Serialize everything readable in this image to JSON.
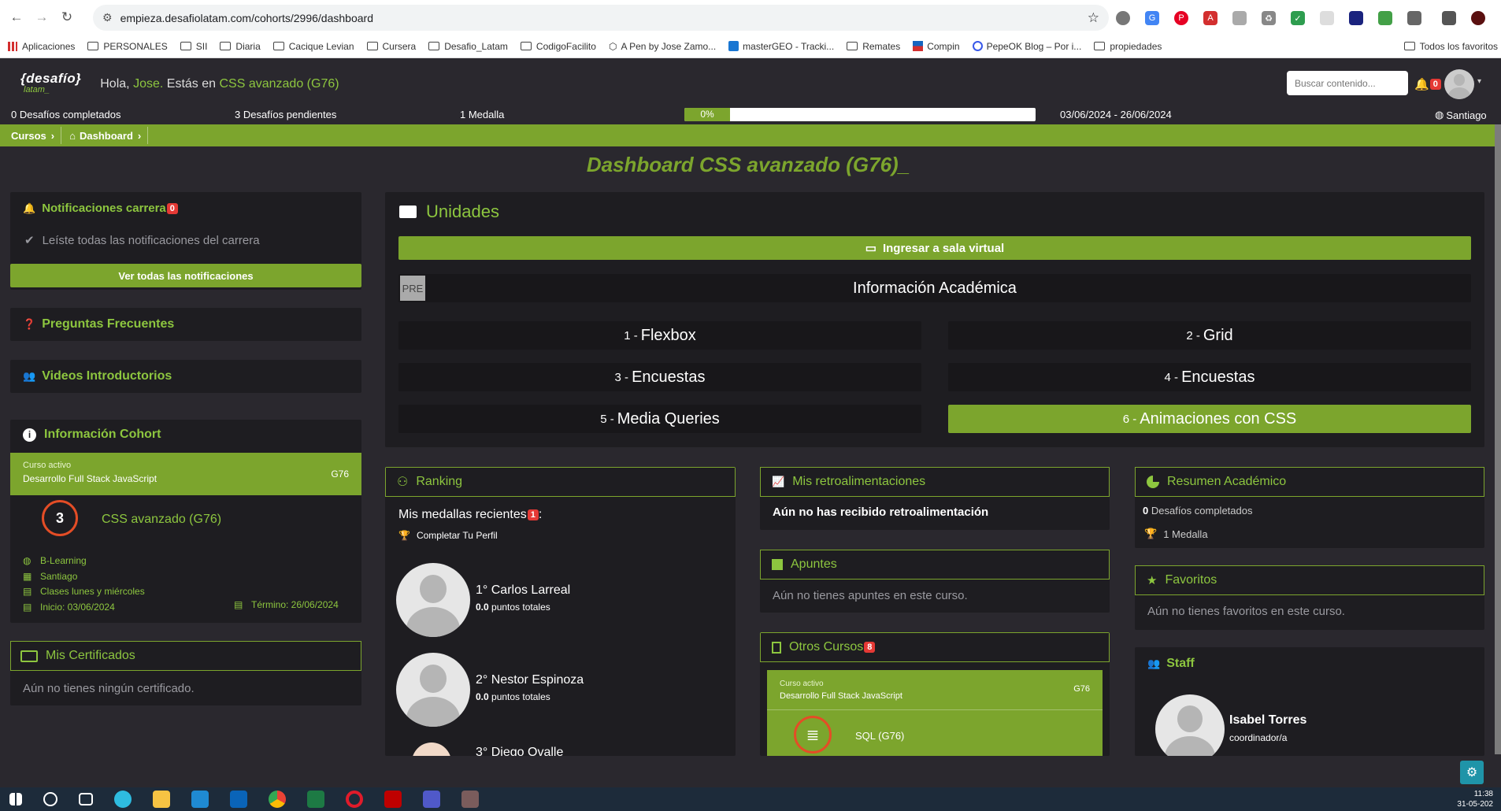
{
  "browser": {
    "url": "empieza.desafiolatam.com/cohorts/2996/dashboard",
    "bookmarks": [
      "Aplicaciones",
      "PERSONALES",
      "SII",
      "Diaria",
      "Cacique Levian",
      "Cursera",
      "Desafio_Latam",
      "CodigoFacilito",
      "A Pen by Jose Zamo...",
      "masterGEO - Tracki...",
      "Remates",
      "Compin",
      "PepeOK Blog – Por i...",
      "propiedades"
    ],
    "all_favorites": "Todos los favoritos"
  },
  "header": {
    "logo_top": "{desafío}",
    "logo_bottom": "latam_",
    "hola": "Hola,",
    "user": "Jose.",
    "estas_en": "Estás en",
    "course": "CSS avanzado (G76)",
    "search_placeholder": "Buscar contenido...",
    "notif_count": "0"
  },
  "status": {
    "completed": "0 Desafíos completados",
    "pending": "3 Desafíos pendientes",
    "medals": "1 Medalla",
    "progress_label": "0%",
    "progress_value": 0.05,
    "dates": "03/06/2024 - 26/06/2024",
    "location": "Santiago"
  },
  "breadcrumb": {
    "cursos": "Cursos",
    "dashboard": "Dashboard"
  },
  "page_title": "Dashboard CSS avanzado (G76)_",
  "notifications": {
    "title": "Notificaciones carrera",
    "count": "0",
    "read_all": "Leíste todas las notificaciones del carrera",
    "button": "Ver todas las notificaciones"
  },
  "faq": "Preguntas Frecuentes",
  "videos": "Videos Introductorios",
  "cohort": {
    "title": "Información Cohort",
    "active_label": "Curso activo",
    "program": "Desarrollo Full Stack JavaScript",
    "code": "G76",
    "course_name": "CSS avanzado (G76)",
    "modality": "B-Learning",
    "city": "Santiago",
    "schedule": "Clases lunes y miércoles",
    "start": "Inicio: 03/06/2024",
    "end": "Término: 26/06/2024"
  },
  "certificates": {
    "title": "Mis Certificados",
    "empty": "Aún no tienes ningún certificado."
  },
  "units": {
    "title": "Unidades",
    "virtual_room": "Ingresar a sala virtual",
    "pre_tag": "PRE",
    "academic_info": "Información Académica",
    "items": [
      {
        "num": "1 -",
        "name": "Flexbox"
      },
      {
        "num": "2 -",
        "name": "Grid"
      },
      {
        "num": "3 -",
        "name": "Encuestas"
      },
      {
        "num": "4 -",
        "name": "Encuestas"
      },
      {
        "num": "5 -",
        "name": "Media Queries"
      },
      {
        "num": "6 -",
        "name": "Animaciones con CSS"
      }
    ]
  },
  "ranking": {
    "title": "Ranking",
    "recent_medals": "Mis medallas recientes",
    "medal_count": "1",
    "colon": ":",
    "medal": "Completar Tu Perfil",
    "entries": [
      {
        "pos": "1°",
        "name": "Carlos Larreal",
        "points": "0.0",
        "points_label": "puntos totales"
      },
      {
        "pos": "2°",
        "name": "Nestor Espinoza",
        "points": "0.0",
        "points_label": "puntos totales"
      },
      {
        "pos": "3°",
        "name": "Diego Ovalle"
      }
    ]
  },
  "feedback": {
    "title": "Mis retroalimentaciones",
    "empty": "Aún no has recibido retroalimentación"
  },
  "notes": {
    "title": "Apuntes",
    "empty": "Aún no tienes apuntes en este curso."
  },
  "other_courses": {
    "title": "Otros Cursos",
    "count": "8",
    "active_label": "Curso activo",
    "program": "Desarrollo Full Stack JavaScript",
    "code": "G76",
    "course": "SQL (G76)"
  },
  "summary": {
    "title": "Resumen Académico",
    "completed_num": "0",
    "completed_label": "Desafíos completados",
    "medals": "1 Medalla"
  },
  "favorites": {
    "title": "Favoritos",
    "empty": "Aún no tienes favoritos en este curso."
  },
  "staff": {
    "title": "Staff",
    "name": "Isabel Torres",
    "role": "coordinador/a"
  },
  "taskbar": {
    "time": "11:38",
    "date": "31-05-202"
  }
}
